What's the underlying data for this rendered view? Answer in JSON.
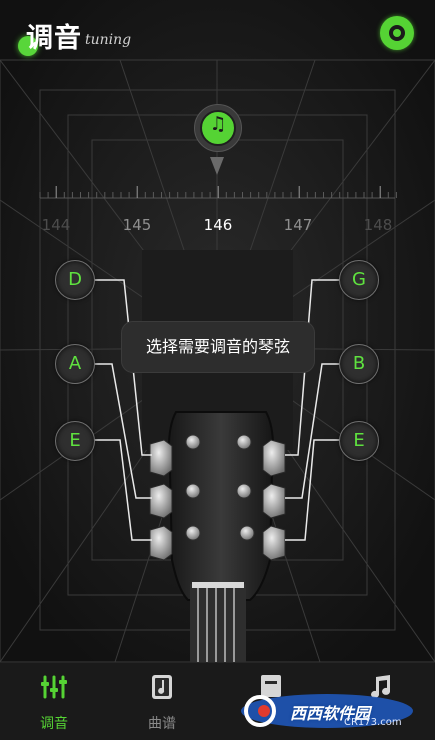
{
  "header": {
    "title": "调音",
    "subtitle": "tuning"
  },
  "icons": {
    "settings": "settings-gear-icon",
    "music": "music-note-icon",
    "logo": "green-dot-icon"
  },
  "colors": {
    "accent": "#55d334",
    "background": "#141414",
    "note_text": "#5fe23f"
  },
  "tuner": {
    "music_glyph": "♫",
    "scale": [
      "144",
      "145",
      "146",
      "147",
      "148"
    ],
    "current_value": "146"
  },
  "strings": {
    "left": [
      {
        "note": "D"
      },
      {
        "note": "A"
      },
      {
        "note": "E"
      }
    ],
    "right": [
      {
        "note": "G"
      },
      {
        "note": "B"
      },
      {
        "note": "E"
      }
    ]
  },
  "hint": "选择需要调音的琴弦",
  "nav": {
    "items": [
      {
        "label": "调音",
        "icon": "tuner-sliders-icon",
        "active": true
      },
      {
        "label": "曲谱",
        "icon": "score-book-icon",
        "active": false
      },
      {
        "label": "",
        "icon": "tab-icon",
        "active": false
      },
      {
        "label": "",
        "icon": "music-note-icon",
        "active": false
      }
    ]
  },
  "watermark": {
    "text": "西西软件园",
    "sub": "CR173.com"
  }
}
